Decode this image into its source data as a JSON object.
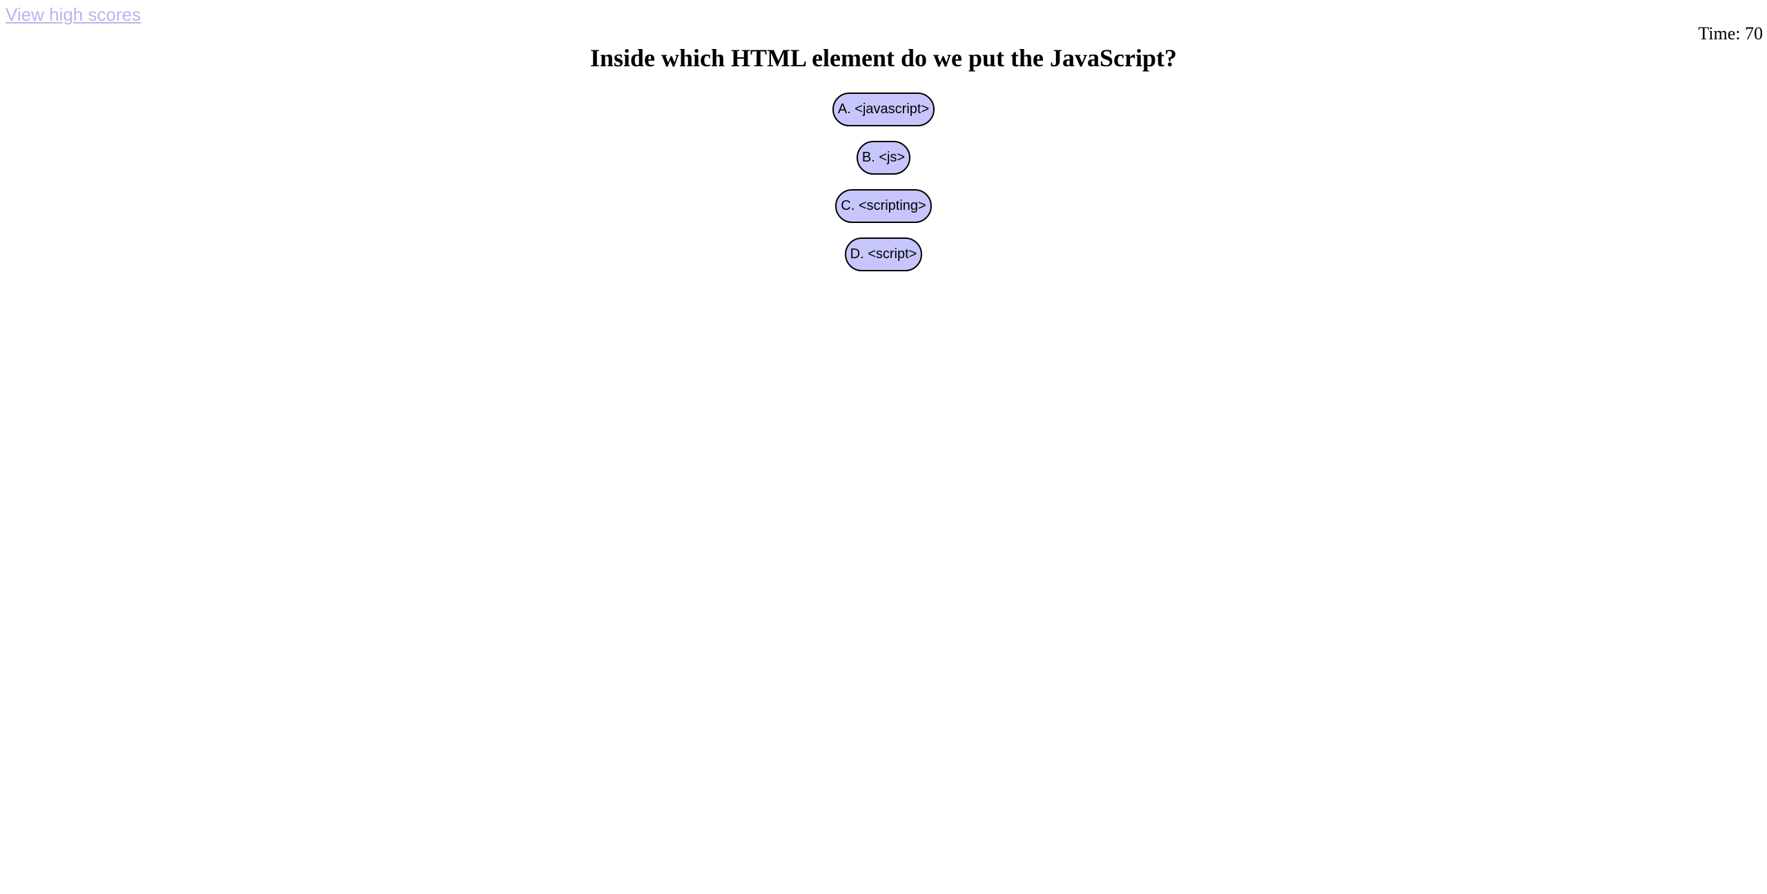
{
  "header": {
    "high_scores_link": "View high scores",
    "timer": "Time: 70"
  },
  "quiz": {
    "question": "Inside which HTML element do we put the JavaScript?",
    "answers": [
      {
        "label": "A. <javascript>"
      },
      {
        "label": "B. <js>"
      },
      {
        "label": "C. <scripting>"
      },
      {
        "label": "D. <script>"
      }
    ]
  },
  "colors": {
    "link": "#b6b6ee",
    "button_fill": "#c6c6fc",
    "button_border": "#000000",
    "text": "#000000"
  }
}
